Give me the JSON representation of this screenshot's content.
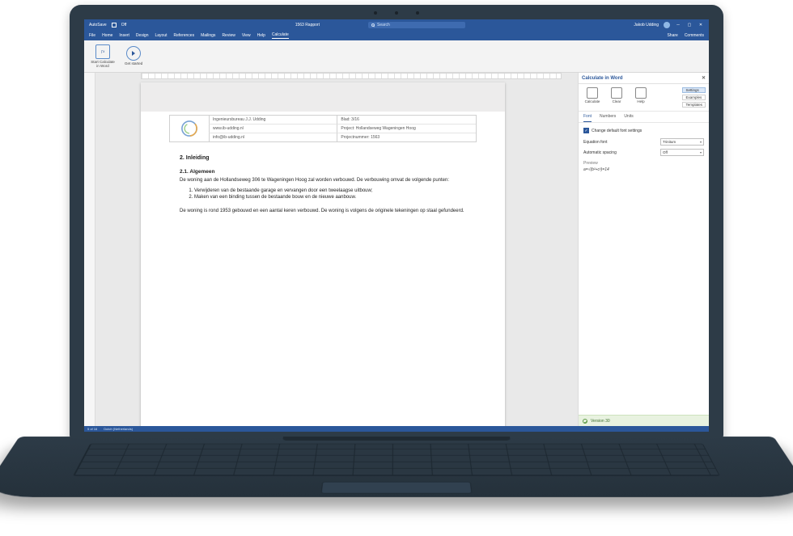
{
  "titlebar": {
    "autosave_label": "AutoSave",
    "autosave_state": "Off",
    "doc_title": "1563 Rapport",
    "search_placeholder": "Search",
    "user_name": "Jakob Udding"
  },
  "menu": {
    "items": [
      "File",
      "Home",
      "Insert",
      "Design",
      "Layout",
      "References",
      "Mailings",
      "Review",
      "View",
      "Help",
      "Calculate"
    ],
    "active": "Calculate",
    "share": "Share",
    "comments": "Comments"
  },
  "ribbon": {
    "btn1": "Start Calculate in Word",
    "btn2": "Get started"
  },
  "letterhead": {
    "r1c1": "Ingenieursbureau J.J. Udding",
    "r1c2": "Blad: 3/16",
    "r2c1": "www.ib-udding.nl",
    "r2c2": "Project: Hollandseweg Wageningen Hoog",
    "r3c1": "info@ib-udding.nl",
    "r3c2": "Projectnummer: 1563"
  },
  "doc": {
    "h2": "2.  Inleiding",
    "h3": "2.1. Algemeen",
    "p1": "De woning aan de Hollandseweg 306 te Wageningen Hoog zal worden verbouwd. De verbouwing omvat de volgende punten:",
    "li1": "Verwijderen van de bestaande garage en vervangen door een tweelaagse uitbouw;",
    "li2": "Maken van een binding tussen de bestaande bouw en de nieuwe aanbouw.",
    "p2": "De woning is rond 1953 gebouwd en een aantal keren verbouwd. De woning is volgens de originele tekeningen op staal gefundeerd."
  },
  "taskpane": {
    "title": "Calculate in Word",
    "tool_calculate": "Calculate",
    "tool_clear": "Clear",
    "tool_help": "Help",
    "side_settings": "Settings",
    "side_examples": "Examples",
    "side_templates": "Templates",
    "tab_font": "Font",
    "tab_numbers": "Numbers",
    "tab_units": "Units",
    "checkbox": "Change default font settings",
    "field_font_label": "Equation font",
    "field_font_value": "Trinitum",
    "field_spacing_label": "Automatic spacing",
    "field_spacing_value": "Off",
    "preview_label": "Preview",
    "preview_value": "a=√(b²+c²)=14",
    "version": "Version 30"
  },
  "statusbar": {
    "page": "5 of 16",
    "words": "Dutch (Netherlands)"
  }
}
